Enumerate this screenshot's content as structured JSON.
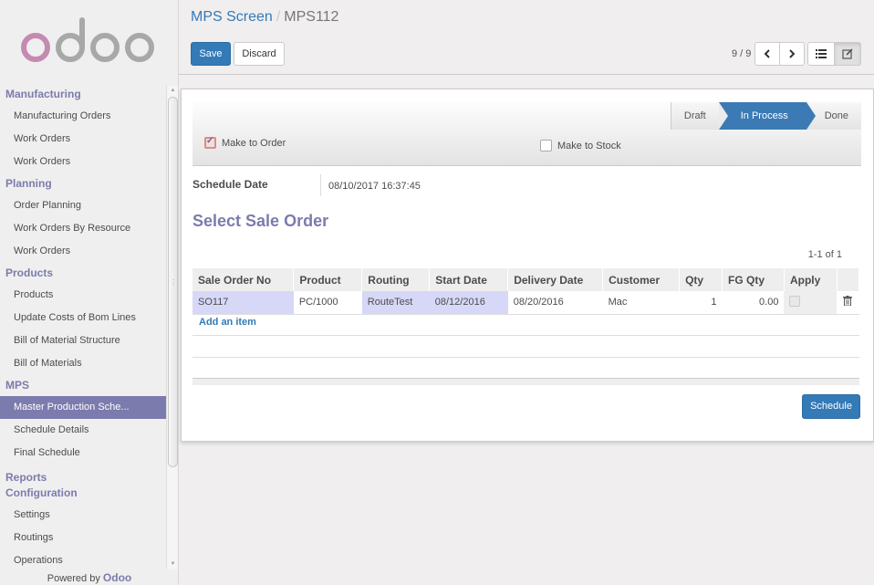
{
  "app": {
    "brand": "odoo",
    "powered_by_prefix": "Powered by",
    "powered_by_brand": "Odoo"
  },
  "sidebar": {
    "groups": [
      {
        "title": "Manufacturing",
        "items": [
          "Manufacturing Orders",
          "Work Orders",
          "Work Orders"
        ]
      },
      {
        "title": "Planning",
        "items": [
          "Order Planning",
          "Work Orders By Resource",
          "Work Orders"
        ]
      },
      {
        "title": "Products",
        "items": [
          "Products",
          "Update Costs of Bom Lines",
          "Bill of Material Structure",
          "Bill of Materials"
        ]
      },
      {
        "title": "MPS",
        "items": [
          "Master Production Sche...",
          "Schedule Details",
          "Final Schedule"
        ]
      },
      {
        "title": "Reports",
        "items": []
      },
      {
        "title": "Configuration",
        "items": [
          "Settings",
          "Routings",
          "Operations"
        ]
      }
    ],
    "active_item": "Master Production Sche..."
  },
  "control_panel": {
    "breadcrumb": {
      "parent": "MPS Screen",
      "separator": "/",
      "current": "MPS112"
    },
    "save_label": "Save",
    "discard_label": "Discard",
    "pager": "9 / 9",
    "icons": {
      "prev": "chevron-left-icon",
      "next": "chevron-right-icon",
      "list_view": "list-icon",
      "form_view": "edit-icon"
    }
  },
  "form": {
    "statusbar": {
      "stages": [
        "Draft",
        "In Process",
        "Done"
      ],
      "active": "In Process"
    },
    "make_to_order": {
      "label": "Make to Order",
      "checked": true
    },
    "make_to_stock": {
      "label": "Make to Stock",
      "checked": false
    },
    "schedule_date": {
      "label": "Schedule Date",
      "value": "08/10/2017 16:37:45"
    },
    "section_title": "Select Sale Order",
    "list_pager": "1-1 of 1",
    "table": {
      "columns": [
        "Sale Order No",
        "Product",
        "Routing",
        "Start Date",
        "Delivery Date",
        "Customer",
        "Qty",
        "FG Qty",
        "Apply"
      ],
      "rows": [
        {
          "sale_order_no": "SO117",
          "product": "PC/1000",
          "routing": "RouteTest",
          "start_date": "08/12/2016",
          "delivery_date": "08/20/2016",
          "customer": "Mac",
          "qty": "1",
          "fg_qty": "0.00",
          "apply": false
        }
      ]
    },
    "add_item_label": "Add an item",
    "schedule_label": "Schedule"
  },
  "colors": {
    "primary": "#337ab7",
    "accent": "#7c7bad",
    "highlight": "#d7d7f8",
    "status_active": "#3c7ab5"
  }
}
